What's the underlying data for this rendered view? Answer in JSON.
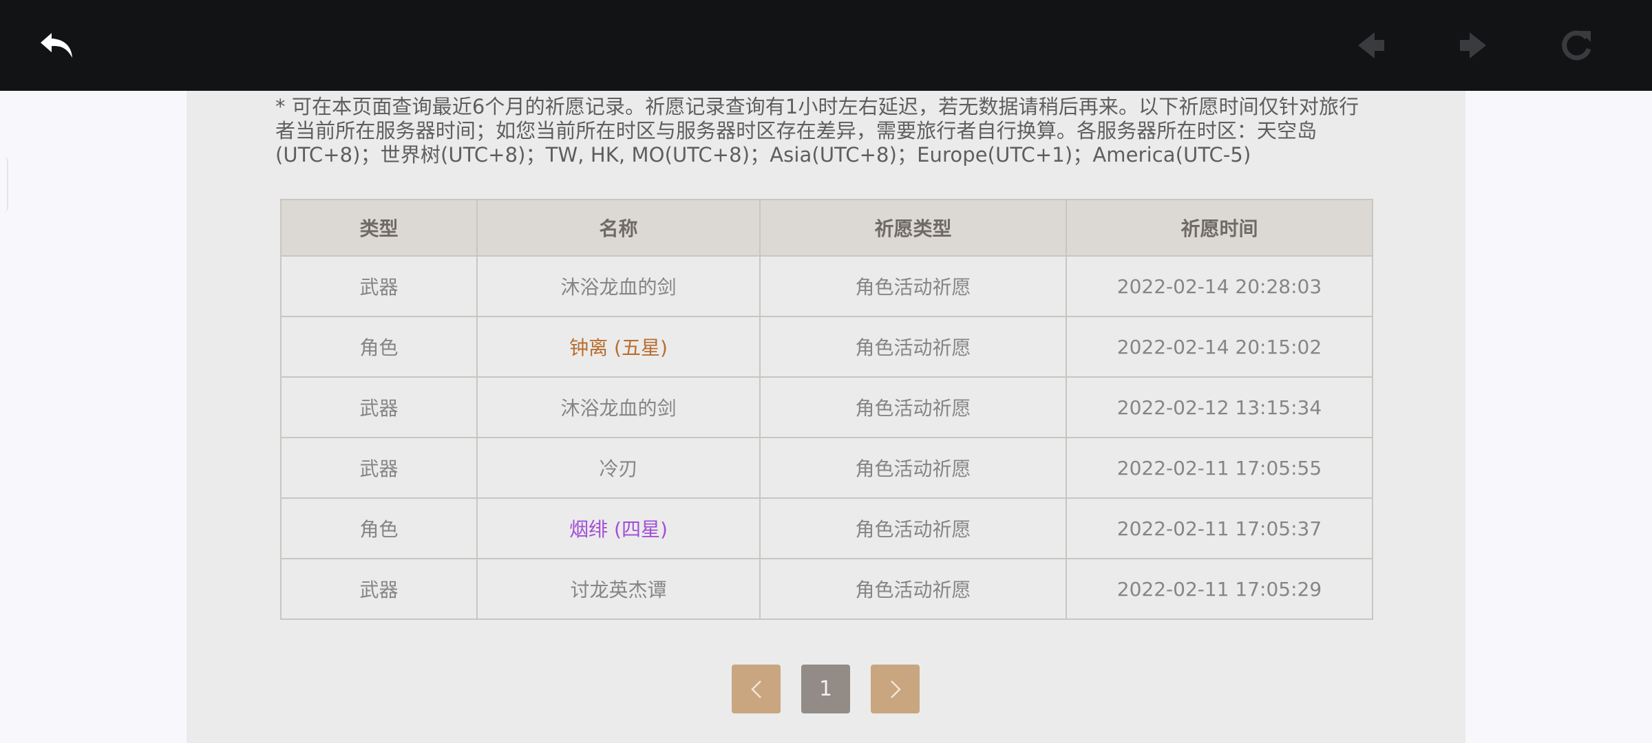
{
  "browser": {
    "icons": {
      "back": "back-arrow-icon",
      "prev": "prev-icon",
      "next": "next-icon",
      "reload": "reload-icon"
    }
  },
  "notice": "* 可在本页面查询最近6个月的祈愿记录。祈愿记录查询有1小时左右延迟，若无数据请稍后再来。以下祈愿时间仅针对旅行者当前所在服务器时间；如您当前所在时区与服务器时区存在差异，需要旅行者自行换算。各服务器所在时区：天空岛(UTC+8)；世界树(UTC+8)；TW, HK, MO(UTC+8)；Asia(UTC+8)；Europe(UTC+1)；America(UTC-5)",
  "table": {
    "headers": [
      "类型",
      "名称",
      "祈愿类型",
      "祈愿时间"
    ],
    "rows": [
      {
        "type": "武器",
        "name": "沐浴龙血的剑",
        "wish": "角色活动祈愿",
        "time": "2022-02-14 20:28:03",
        "rarity": ""
      },
      {
        "type": "角色",
        "name": "钟离 (五星)",
        "wish": "角色活动祈愿",
        "time": "2022-02-14 20:15:02",
        "rarity": "5"
      },
      {
        "type": "武器",
        "name": "沐浴龙血的剑",
        "wish": "角色活动祈愿",
        "time": "2022-02-12 13:15:34",
        "rarity": ""
      },
      {
        "type": "武器",
        "name": "冷刃",
        "wish": "角色活动祈愿",
        "time": "2022-02-11 17:05:55",
        "rarity": ""
      },
      {
        "type": "角色",
        "name": "烟绯 (四星)",
        "wish": "角色活动祈愿",
        "time": "2022-02-11 17:05:37",
        "rarity": "4"
      },
      {
        "type": "武器",
        "name": "讨龙英杰谭",
        "wish": "角色活动祈愿",
        "time": "2022-02-11 17:05:29",
        "rarity": ""
      }
    ]
  },
  "pagination": {
    "current_page": "1",
    "prev_icon": "chevron-left-icon",
    "next_icon": "chevron-right-icon"
  },
  "colors": {
    "five_star": "#b86e2f",
    "four_star": "#a24fd6",
    "pager_accent": "#c9a680"
  }
}
